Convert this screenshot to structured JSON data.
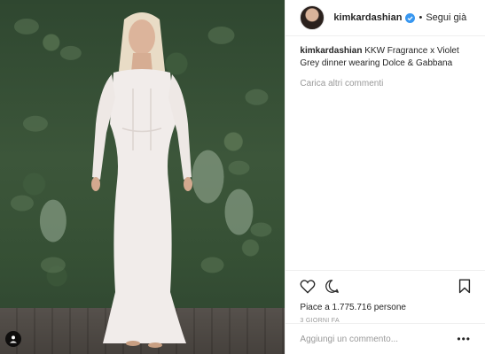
{
  "post": {
    "username": "kimkardashian",
    "follow_status": "Segui già",
    "separator": "•",
    "caption_text": "KKW Fragrance x Violet Grey dinner wearing Dolce & Gabbana",
    "load_more": "Carica altri commenti",
    "likes": "Piace a 1.775.716 persone",
    "time_ago": "3 GIORNI FA",
    "comment_placeholder": "Aggiungi un commento...",
    "options": "•••"
  },
  "icons": {
    "verified": "verified-badge-icon",
    "like": "heart-icon",
    "comment": "speech-bubble-icon",
    "save": "bookmark-icon",
    "tagged": "tagged-user-icon"
  },
  "colors": {
    "verified_blue": "#3897f0",
    "text": "#262626",
    "muted": "#999999",
    "divider": "#efefef"
  }
}
